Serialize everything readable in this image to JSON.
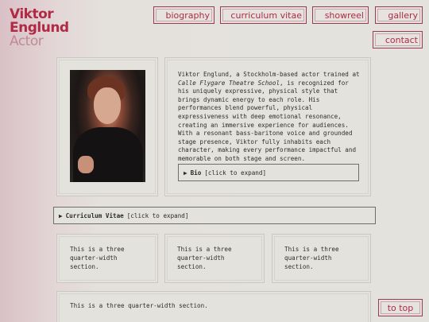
{
  "logo": {
    "line1": "Viktor",
    "line2": "Englund",
    "line3": "Actor"
  },
  "nav": {
    "biography": "biography",
    "cv": "curriculum vitae",
    "showreel": "showreel",
    "gallery": "gallery",
    "contact": "contact"
  },
  "intro": {
    "p1": "Viktor Englund, a Stockholm-based actor trained at ",
    "school": "Calle Flygare Theatre School",
    "p2": ", is recognized for his uniquely expressive, physical style that brings dynamic energy to each role. His performances blend powerful, physical expressiveness with deep emotional resonance, creating an immersive experience for audiences. With a resonant bass-baritone voice and grounded stage presence, Viktor fully inhabits each character, making every performance impactful and memorable on both stage and screen."
  },
  "bio_expander": {
    "arrow": "▶",
    "title": "Bio",
    "hint": "[click to expand]"
  },
  "cv_expander": {
    "arrow": "▶",
    "title": "Curriculum Vitae",
    "hint": "[click to expand]"
  },
  "sections": {
    "s1": "This is a three quarter-width section.",
    "s2": "This is a three quarter-width section.",
    "s3": "This is a three quarter-width section.",
    "s4": "This is a three quarter-width section."
  },
  "to_top": "to top",
  "colors": {
    "accent": "#b02a45",
    "background": "#e4e2dd",
    "border": "#c9c7c2"
  }
}
